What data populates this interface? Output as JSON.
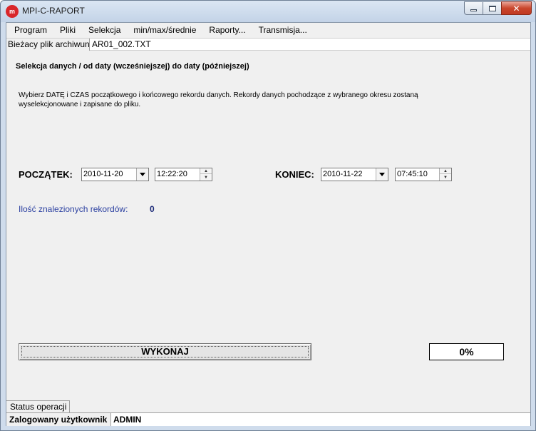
{
  "window": {
    "title": "MPI-C-RAPORT",
    "icon_text": "m"
  },
  "menu": [
    {
      "label": "Program"
    },
    {
      "label": "Pliki"
    },
    {
      "label": "Selekcja"
    },
    {
      "label": "min/max/średnie"
    },
    {
      "label": "Raporty..."
    },
    {
      "label": "Transmisja..."
    }
  ],
  "archive": {
    "label": "Bieżacy plik archiwun",
    "value": "AR01_002.TXT"
  },
  "selection": {
    "heading": "Selekcja danych / od daty (wcześniejszej) do daty (późniejszej)",
    "description": "Wybierz DATĘ i CZAS początkowego i końcowego rekordu danych. Rekordy danych pochodzące z wybranego okresu zostaną wyselekcjonowane i zapisane do pliku.",
    "start_label": "POCZĄTEK:",
    "start_date": "2010-11-20",
    "start_time": "12:22:20",
    "end_label": "KONIEC:",
    "end_date": "2010-11-22",
    "end_time": "07:45:10",
    "found_label": "Ilość znalezionych rekordów:",
    "found_count": "0"
  },
  "actions": {
    "execute_label": "WYKONAJ",
    "progress_text": "0%"
  },
  "status": {
    "tab_label": "Status operacji",
    "user_label": "Zalogowany użytkownik",
    "user_value": "ADMIN"
  },
  "colors": {
    "accent_blue": "#2a3fa0",
    "close_red": "#c9462c"
  }
}
